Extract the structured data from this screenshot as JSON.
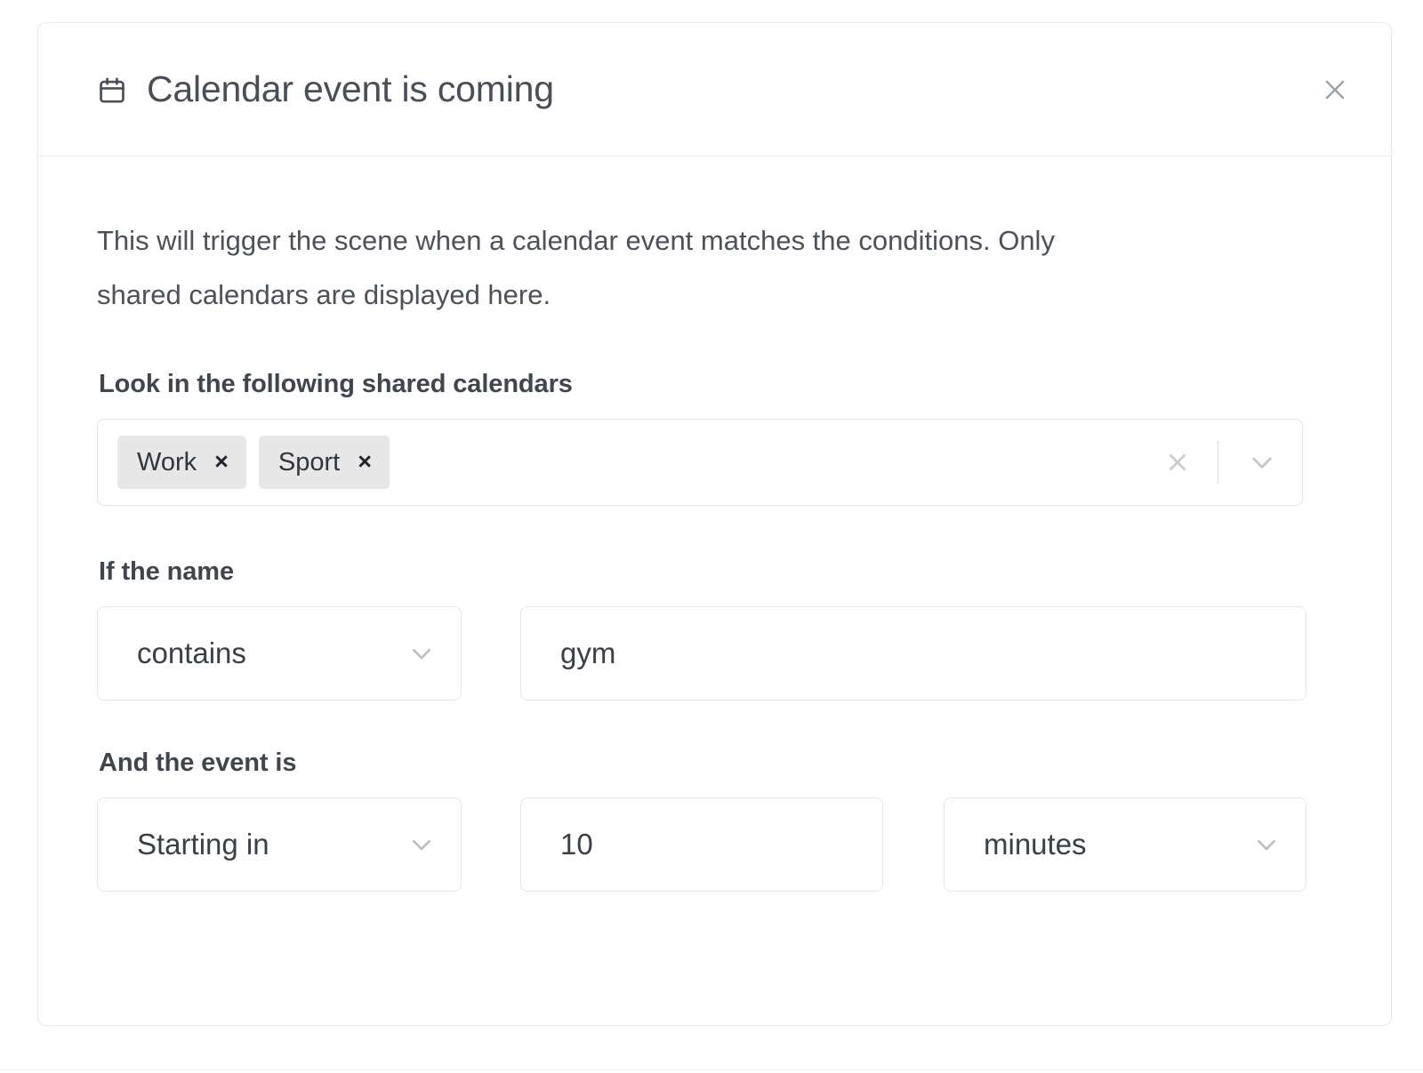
{
  "dialog": {
    "title": "Calendar event is coming",
    "title_icon": "calendar-icon",
    "close_icon": "close-icon",
    "description": "This will trigger the scene when a calendar event matches the conditions. Only shared calendars are displayed here."
  },
  "calendars_field": {
    "label": "Look in the following shared calendars",
    "chips": [
      {
        "label": "Work",
        "remove_icon": "×"
      },
      {
        "label": "Sport",
        "remove_icon": "×"
      }
    ],
    "clear_icon": "clear-icon",
    "dropdown_icon": "chevron-down-icon"
  },
  "name_condition": {
    "label": "If the name",
    "operator": {
      "value": "contains",
      "chevron": "chevron-down-icon"
    },
    "value": {
      "text": "gym",
      "placeholder": ""
    }
  },
  "event_condition": {
    "label": "And the event is",
    "timing": {
      "value": "Starting in",
      "chevron": "chevron-down-icon"
    },
    "amount": {
      "text": "10",
      "placeholder": ""
    },
    "unit": {
      "value": "minutes",
      "chevron": "chevron-down-icon"
    }
  },
  "colors": {
    "card_border": "#e9eaee",
    "text_primary": "#3b4048",
    "text_muted": "#4c515a",
    "chip_bg": "#e7e7e8",
    "control_border": "#e6e8ec",
    "icon_muted": "#b9bcc2"
  }
}
